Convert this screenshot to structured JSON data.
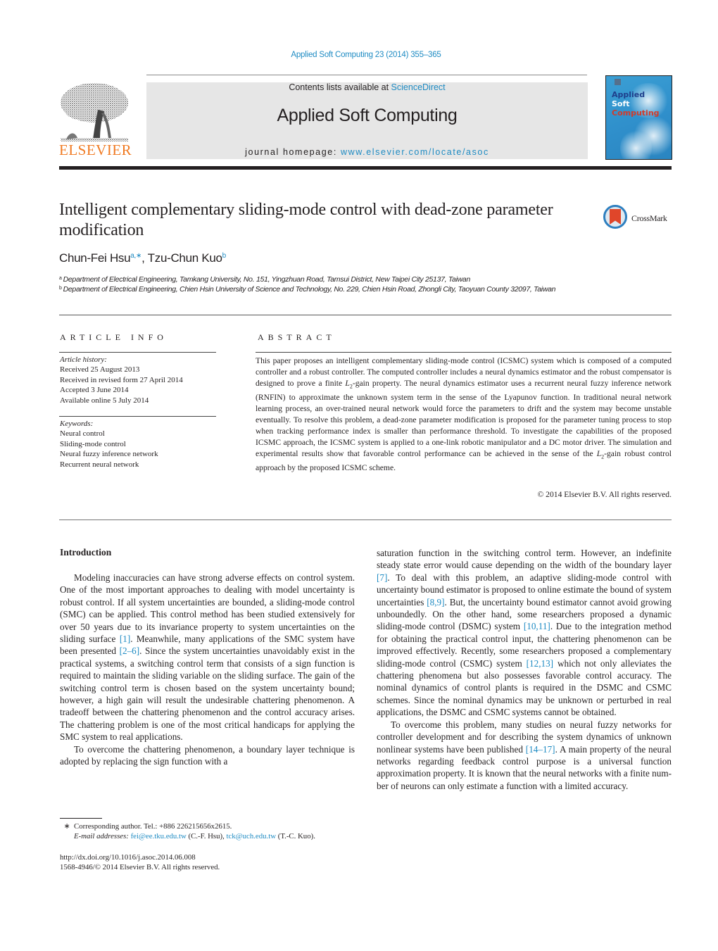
{
  "header": {
    "journal_ref": "Applied Soft Computing 23 (2014) 355–365",
    "contents_prefix": "Contents lists available at ",
    "contents_link": "ScienceDirect",
    "journal_title": "Applied Soft Computing",
    "homepage_prefix": "journal homepage: ",
    "homepage_link": "www.elsevier.com/locate/asoc",
    "publisher_logo_text": "ELSEVIER",
    "cover": {
      "line1": "Applied",
      "line2": "Soft",
      "line3": "Computing"
    },
    "colors": {
      "link": "#1e8bc3",
      "elsevier_orange": "#f07a22",
      "cover_blue": "#2f8fcb",
      "cover_red": "#d23b2a"
    }
  },
  "article": {
    "title": "Intelligent complementary sliding-mode control with dead-zone parameter modification",
    "crossmark_label": "CrossMark",
    "authors": [
      {
        "name": "Chun-Fei Hsu",
        "marks": "a,∗"
      },
      {
        "name": "Tzu-Chun Kuo",
        "marks": "b"
      }
    ],
    "author_separator": ", ",
    "affiliations": [
      {
        "mark": "a",
        "text": "Department of Electrical Engineering, Tamkang University, No. 151, Yingzhuan Road, Tamsui District, New Taipei City 25137, Taiwan"
      },
      {
        "mark": "b",
        "text": "Department of Electrical Engineering, Chien Hsin University of Science and Technology, No. 229, Chien Hsin Road, Zhongli City, Taoyuan County 32097, Taiwan"
      }
    ]
  },
  "article_info": {
    "heading": "ARTICLE INFO",
    "history_label": "Article history:",
    "history": [
      "Received 25 August 2013",
      "Received in revised form 27 April 2014",
      "Accepted 3 June 2014",
      "Available online 5 July 2014"
    ],
    "keywords_label": "Keywords:",
    "keywords": [
      "Neural control",
      "Sliding-mode control",
      "Neural fuzzy inference network",
      "Recurrent neural network"
    ]
  },
  "abstract": {
    "heading": "ABSTRACT",
    "text": "This paper proposes an intelligent complementary sliding-mode control (ICSMC) system which is com­posed of a computed controller and a robust controller. The computed controller includes a neural dynamics estimator and the robust compensator is designed to prove a finite L2-gain property. The neu­ral dynamics estimator uses a recurrent neural fuzzy inference network (RNFIN) to approximate the unknown system term in the sense of the Lyapunov function. In traditional neural network learning pro­cess, an over-trained neural network would force the parameters to drift and the system may become unstable eventually. To resolve this problem, a dead-zone parameter modification is proposed for the parameter tuning process to stop when tracking performance index is smaller than performance thresh­old. To investigate the capabilities of the proposed ICSMC approach, the ICSMC system is applied to a one-link robotic manipulator and a DC motor driver. The simulation and experimental results show that favorable control performance can be achieved in the sense of the L2-gain robust control approach by the proposed ICSMC scheme.",
    "copyright": "© 2014 Elsevier B.V. All rights reserved."
  },
  "body": {
    "section_heading": "Introduction",
    "left_column": [
      {
        "segments": [
          {
            "t": "Modeling inaccuracies can have strong adverse effects on con­trol system. One of the most important approaches to dealing with model uncertainty is robust control. If all system uncertainties are bounded, a sliding-mode control (SMC) can be applied. This control method has been studied extensively for over 50 years due to its invariance property to system uncertainties on the sliding surface "
          },
          {
            "t": "[1]",
            "ref": true
          },
          {
            "t": ". Meanwhile, many applications of the SMC system have been presented "
          },
          {
            "t": "[2–6]",
            "ref": true
          },
          {
            "t": ". Since the system uncertainties unavoidably exist in the practical systems, a switching control term that consists of a sign function is required to maintain the sliding variable on the slid­ing surface. The gain of the switching control term is chosen based on the system uncertainty bound; however, a high gain will result the undesirable chattering phenomenon. A tradeoff between the chattering phenomenon and the control accuracy arises. The chat­tering problem is one of the most critical handicaps for applying the SMC system to real applications."
          }
        ]
      },
      {
        "segments": [
          {
            "t": "To overcome the chattering phenomenon, a boundary layer technique is adopted by replacing the sign function with a"
          }
        ]
      }
    ],
    "right_column": [
      {
        "noindent": true,
        "segments": [
          {
            "t": "saturation function in the switching control term. However, an indefinite steady state error would cause depending on the width of the boundary layer "
          },
          {
            "t": "[7]",
            "ref": true
          },
          {
            "t": ". To deal with this problem, an adap­tive sliding-mode control with uncertainty bound estimator is proposed to online estimate the bound of system uncertainties "
          },
          {
            "t": "[8,9]",
            "ref": true
          },
          {
            "t": ". But, the uncertainty bound estimator cannot avoid grow­ing unboundedly. On the other hand, some researchers proposed a dynamic sliding-mode control (DSMC) system "
          },
          {
            "t": "[10,11]",
            "ref": true
          },
          {
            "t": ". Due to the integration method for obtaining the practical control input, the chattering phenomenon can be improved effectively. Recently, some researchers proposed a complementary sliding-mode con­trol (CSMC) system "
          },
          {
            "t": "[12,13]",
            "ref": true
          },
          {
            "t": " which not only alleviates the chattering phenomena but also possesses favorable control accuracy. The nominal dynamics of control plants is required in the DSMC and CSMC schemes. Since the nominal dynamics may be unknown or perturbed in real applications, the DSMC and CSMC systems cannot be obtained."
          }
        ]
      },
      {
        "segments": [
          {
            "t": "To overcome this problem, many studies on neural fuzzy networks for controller development and for describing the sys­tem dynamics of unknown nonlinear systems have been published "
          },
          {
            "t": "[14–17]",
            "ref": true
          },
          {
            "t": ". A main property of the neural networks regarding feedback control purpose is a universal function approximation property. It is known that the neural networks with a finite num­ber of neurons can only estimate a function with a limited accuracy."
          }
        ]
      }
    ]
  },
  "footnotes": {
    "corresponding_mark": "∗",
    "corresponding_text": "Corresponding author. Tel.: +886 226215656x2615.",
    "email_label": "E-mail addresses:",
    "email1": "fei@ee.tku.edu.tw",
    "email1_owner": " (C.-F. Hsu), ",
    "email2": "tck@uch.edu.tw",
    "email2_owner": " (T.-C. Kuo).",
    "doi": "http://dx.doi.org/10.1016/j.asoc.2014.06.008",
    "issn": "1568-4946/© 2014 Elsevier B.V. All rights reserved."
  }
}
